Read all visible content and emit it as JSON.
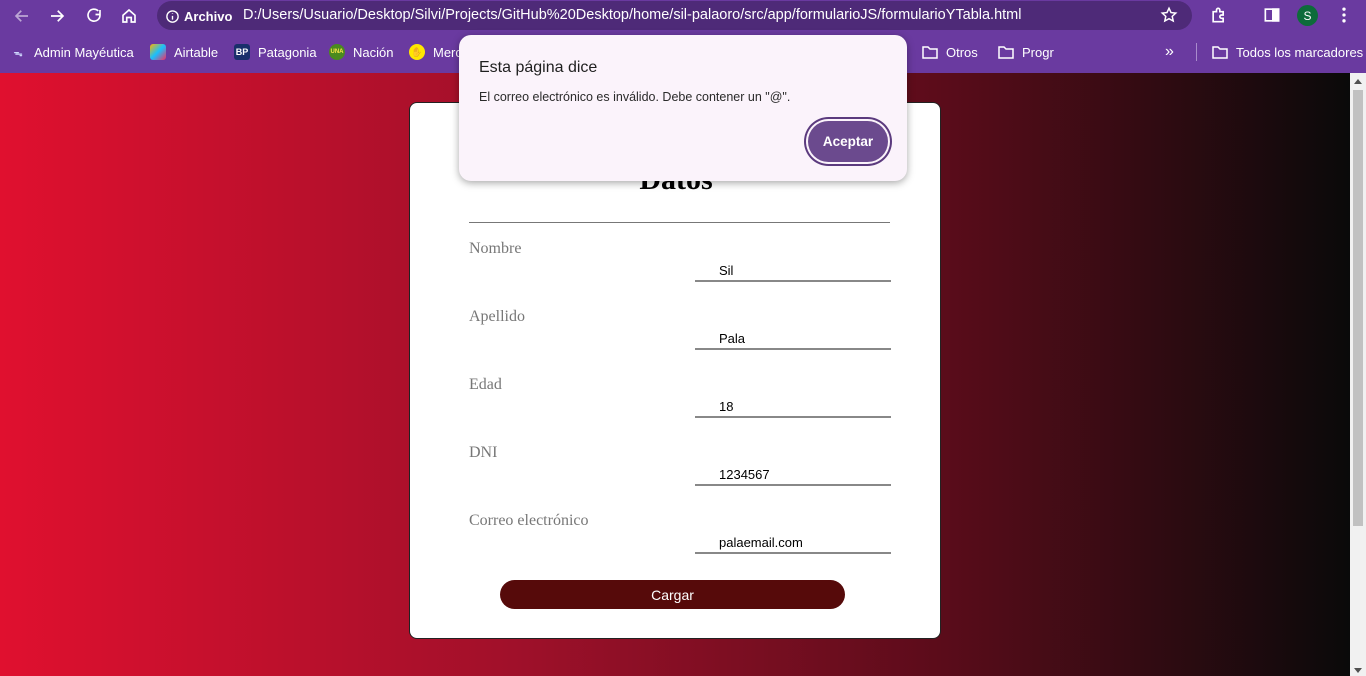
{
  "browser": {
    "site_badge": "Archivo",
    "url": "D:/Users/Usuario/Desktop/Silvi/Projects/GitHub%20Desktop/home/sil-palaoro/src/app/formularioJS/formularioYTabla.html",
    "profile_initial": "S"
  },
  "bookmarks": {
    "items": [
      "Admin Mayéutica",
      "Airtable",
      "Patagonia",
      "Nación",
      "Merc",
      "Otros",
      "Progr"
    ],
    "all_bookmarks": "Todos los marcadores",
    "patagonia_icon_text": "BP",
    "nacion_icon_text": "UNA"
  },
  "form": {
    "title": "Datos",
    "fields": [
      {
        "label": "Nombre",
        "value": "Sil"
      },
      {
        "label": "Apellido",
        "value": "Pala"
      },
      {
        "label": "Edad",
        "value": "18"
      },
      {
        "label": "DNI",
        "value": "1234567"
      },
      {
        "label": "Correo electrónico",
        "value": "palaemail.com"
      }
    ],
    "submit_label": "Cargar"
  },
  "dialog": {
    "title": "Esta página dice",
    "message": "El correo electrónico es inválido. Debe contener un \"@\".",
    "ok_label": "Aceptar"
  },
  "colors": {
    "chrome": "#6a3aa0",
    "gradient_start": "#e0102f",
    "gradient_end": "#0a0a0a",
    "submit_button": "#560a0a",
    "dialog_button": "#6b4a8e"
  }
}
